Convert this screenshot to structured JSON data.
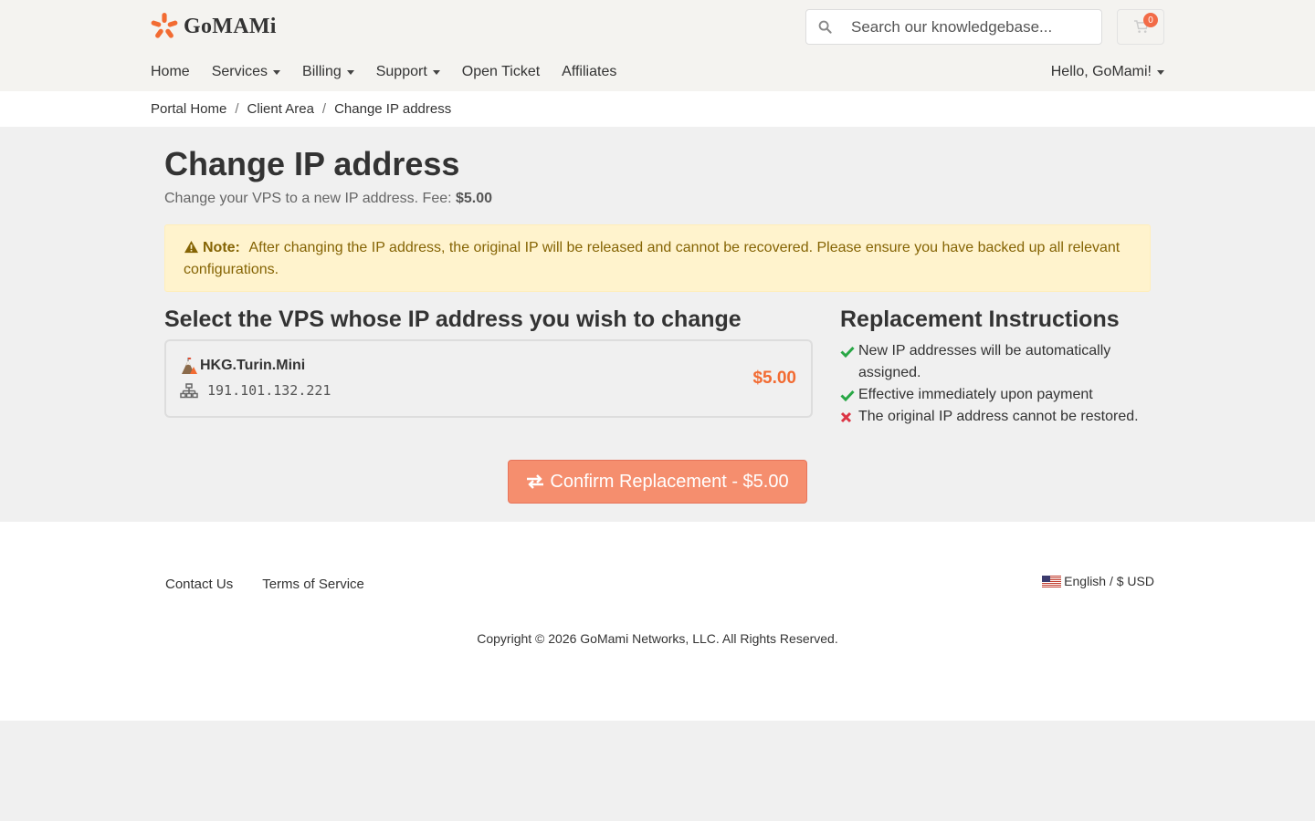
{
  "brand": {
    "name": "GoMAMi",
    "accent": "#f26b32"
  },
  "search": {
    "placeholder": "Search our knowledgebase..."
  },
  "cart": {
    "count": "0"
  },
  "nav": {
    "items": [
      {
        "label": "Home",
        "dropdown": false
      },
      {
        "label": "Services",
        "dropdown": true
      },
      {
        "label": "Billing",
        "dropdown": true
      },
      {
        "label": "Support",
        "dropdown": true
      },
      {
        "label": "Open Ticket",
        "dropdown": false
      },
      {
        "label": "Affiliates",
        "dropdown": false
      }
    ],
    "user_greeting": "Hello, GoMami!"
  },
  "breadcrumb": [
    "Portal Home",
    "Client Area",
    "Change IP address"
  ],
  "page": {
    "title": "Change IP address",
    "subtitle": "Change your VPS to a new IP address. Fee: ",
    "fee": "$5.00"
  },
  "alert": {
    "label": "Note:",
    "text": "After changing the IP address, the original IP will be released and cannot be recovered. Please ensure you have backed up all relevant configurations."
  },
  "select_section": {
    "heading": "Select the VPS whose IP address you wish to change",
    "vps": [
      {
        "name": "HKG.Turin.Mini",
        "ip": "191.101.132.221",
        "price": "$5.00"
      }
    ]
  },
  "instructions": {
    "heading": "Replacement Instructions",
    "items": [
      {
        "icon": "check-icon",
        "color": "#28a745",
        "text": "New IP addresses will be automatically assigned."
      },
      {
        "icon": "check-icon",
        "color": "#28a745",
        "text": "Effective immediately upon payment"
      },
      {
        "icon": "x-icon",
        "color": "#dc3545",
        "text": "The original IP address cannot be restored."
      }
    ]
  },
  "confirm_button": {
    "label": "Confirm Replacement - $5.00",
    "color": "#f58e6e"
  },
  "footer": {
    "links": [
      "Contact Us",
      "Terms of Service"
    ],
    "language": "English / $ USD",
    "copyright": "Copyright © 2026 GoMami Networks, LLC. All Rights Reserved."
  }
}
